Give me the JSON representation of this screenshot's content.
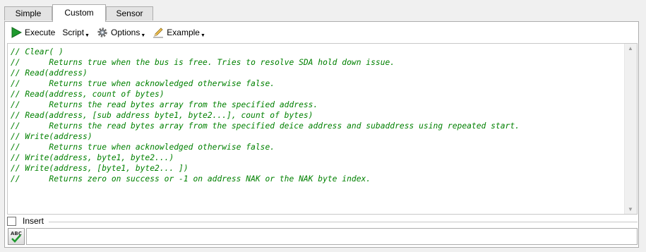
{
  "tabs": [
    {
      "label": "Simple",
      "active": false
    },
    {
      "label": "Custom",
      "active": true
    },
    {
      "label": "Sensor",
      "active": false
    }
  ],
  "toolbar": {
    "execute": {
      "label": "Execute",
      "icon": "play-icon"
    },
    "script": {
      "label": "Script",
      "icon": "none"
    },
    "options": {
      "label": "Options",
      "icon": "gear-icon"
    },
    "example": {
      "label": "Example",
      "icon": "pencil-icon"
    }
  },
  "editor": {
    "lines": [
      "// Clear( )",
      "//      Returns true when the bus is free. Tries to resolve SDA hold down issue.",
      "// Read(address)",
      "//      Returns true when acknowledged otherwise false.",
      "// Read(address, count of bytes)",
      "//      Returns the read bytes array from the specified address.",
      "// Read(address, [sub address byte1, byte2...], count of bytes)",
      "//      Returns the read bytes array from the specified deice address and subaddress using repeated start.",
      "// Write(address)",
      "//      Returns true when acknowledged otherwise false.",
      "// Write(address, byte1, byte2...)",
      "// Write(address, [byte1, byte2... ])",
      "//      Returns zero on success or -1 on address NAK or the NAK byte index."
    ],
    "text_color": "#008000"
  },
  "insert": {
    "label": "Insert",
    "checked": false
  },
  "command_input": {
    "value": "",
    "placeholder": ""
  }
}
